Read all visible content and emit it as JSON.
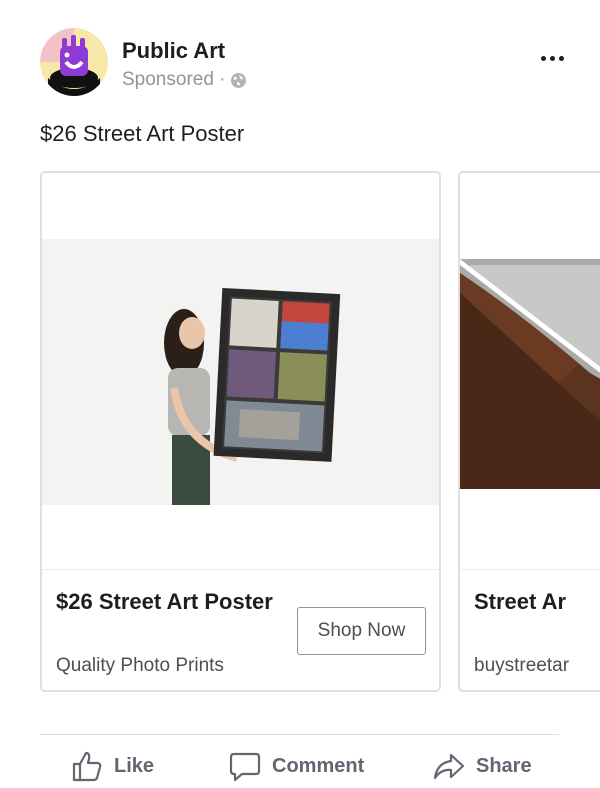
{
  "header": {
    "page_name": "Public Art",
    "sponsored_label": "Sponsored · ",
    "privacy_icon": "globe-icon",
    "more_icon": "more-options-icon"
  },
  "post": {
    "text": "$26 Street Art Poster"
  },
  "carousel": {
    "cards": [
      {
        "title": "$26 Street Art Poster",
        "description": "Quality Photo Prints",
        "cta": "Shop Now"
      },
      {
        "title": "Street Ar",
        "description": "buystreetar"
      }
    ]
  },
  "actions": {
    "like": "Like",
    "comment": "Comment",
    "share": "Share"
  },
  "colors": {
    "primary_text": "#1c1e21",
    "secondary_text": "#90949c",
    "action_text": "#606770",
    "border": "#dddfe2"
  }
}
